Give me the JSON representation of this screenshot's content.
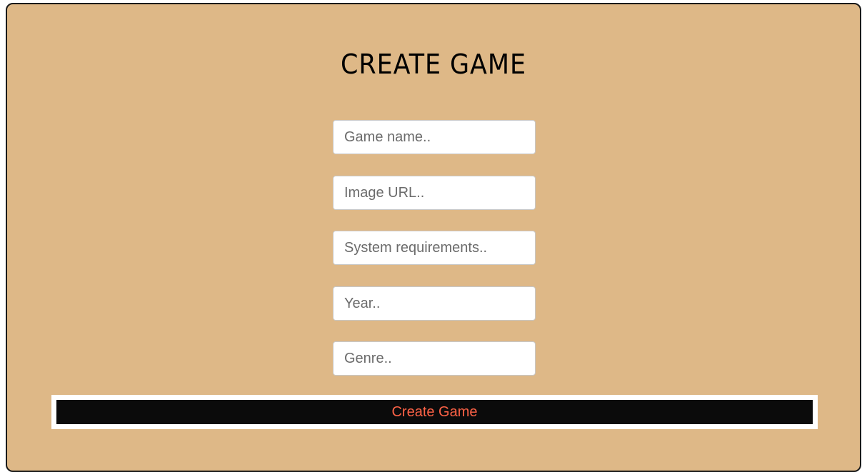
{
  "form": {
    "title": "CREATE GAME",
    "fields": {
      "game_name": {
        "placeholder": "Game name..",
        "value": ""
      },
      "image_url": {
        "placeholder": "Image URL..",
        "value": ""
      },
      "system_requirements": {
        "placeholder": "System requirements..",
        "value": ""
      },
      "year": {
        "placeholder": "Year..",
        "value": ""
      },
      "genre": {
        "placeholder": "Genre..",
        "value": ""
      }
    },
    "submit_label": "Create Game"
  },
  "colors": {
    "card_background": "#deb887",
    "button_background": "#0b0b0b",
    "button_text": "#ff6347"
  }
}
